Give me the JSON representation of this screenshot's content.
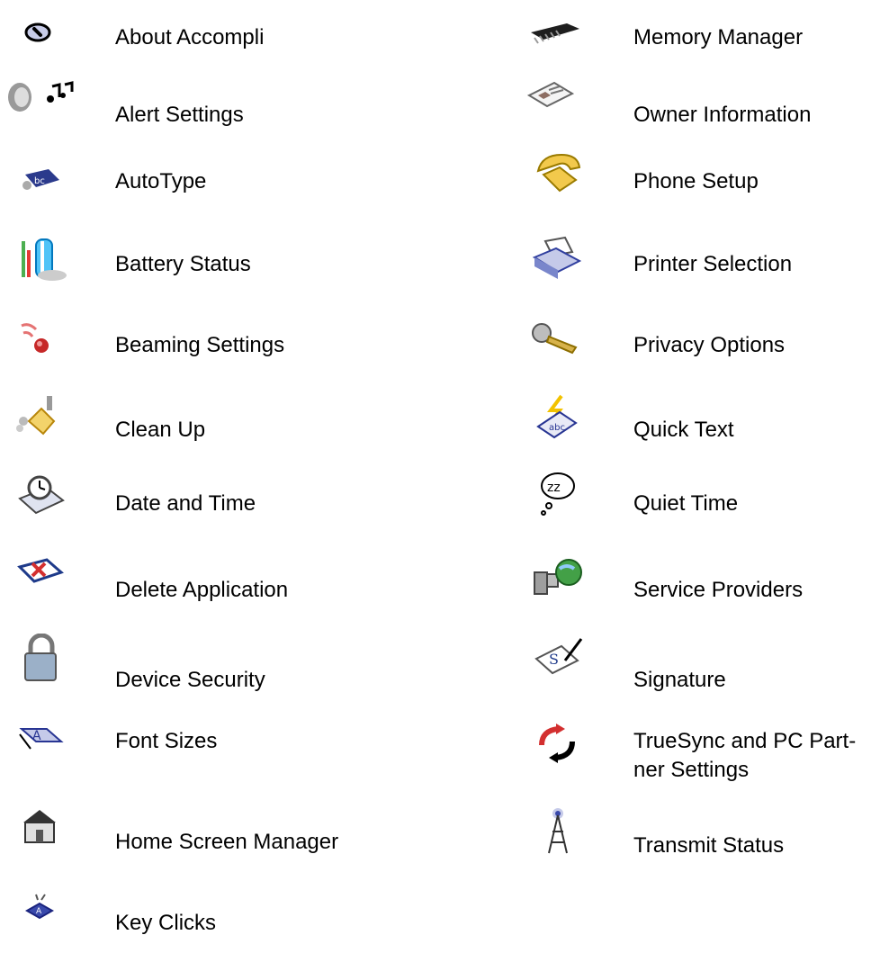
{
  "settings": {
    "left": [
      {
        "label": "About Accompli",
        "icon": "info-icon"
      },
      {
        "label": "Alert Settings",
        "icon": "speaker-music-icon"
      },
      {
        "label": "AutoType",
        "icon": "autotype-icon"
      },
      {
        "label": "Battery Status",
        "icon": "battery-icon"
      },
      {
        "label": "Beaming Settings",
        "icon": "beam-icon"
      },
      {
        "label": "Clean Up",
        "icon": "broom-icon"
      },
      {
        "label": "Date and Time",
        "icon": "clock-calendar-icon"
      },
      {
        "label": "Delete Application",
        "icon": "delete-app-icon"
      },
      {
        "label": "Device Security",
        "icon": "padlock-icon"
      },
      {
        "label": "Font Sizes",
        "icon": "font-size-icon"
      },
      {
        "label": "Home Screen Manager",
        "icon": "house-icon"
      },
      {
        "label": "Key Clicks",
        "icon": "key-click-icon"
      }
    ],
    "right": [
      {
        "label": "Memory Manager",
        "icon": "memory-chip-icon"
      },
      {
        "label": "Owner Information",
        "icon": "id-card-icon"
      },
      {
        "label": "Phone Setup",
        "icon": "phone-icon"
      },
      {
        "label": "Printer Selection",
        "icon": "printer-icon"
      },
      {
        "label": "Privacy Options",
        "icon": "keys-icon"
      },
      {
        "label": "Quick Text",
        "icon": "quick-text-icon"
      },
      {
        "label": "Quiet Time",
        "icon": "sleep-bubble-icon"
      },
      {
        "label": "Service Providers",
        "icon": "computer-globe-icon"
      },
      {
        "label": "Signature",
        "icon": "signature-icon"
      },
      {
        "label": "TrueSync and PC Part-\nner Settings",
        "icon": "sync-arrows-icon"
      },
      {
        "label": "Transmit Status",
        "icon": "antenna-tower-icon"
      }
    ]
  }
}
